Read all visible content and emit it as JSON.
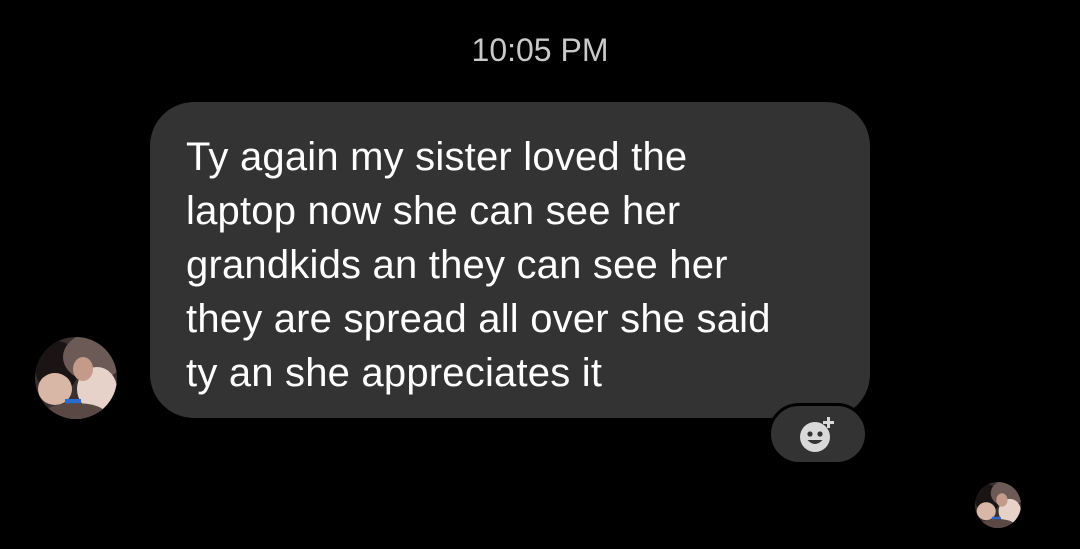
{
  "conversation": {
    "timestamp": "10:05 PM",
    "message": {
      "lines": [
        "Ty again my sister loved the",
        "laptop now she can see her",
        "grandkids an they can see her",
        "they are spread all over she said",
        "ty an she appreciates it"
      ]
    },
    "reaction_button_icon": "add-reaction-icon",
    "sender_avatar": "avatar-photo",
    "read_receipt_avatar": "avatar-photo"
  },
  "colors": {
    "background": "#000000",
    "bubble": "#333333",
    "timestamp_text": "#c9c9c9",
    "message_text": "#ffffff"
  }
}
